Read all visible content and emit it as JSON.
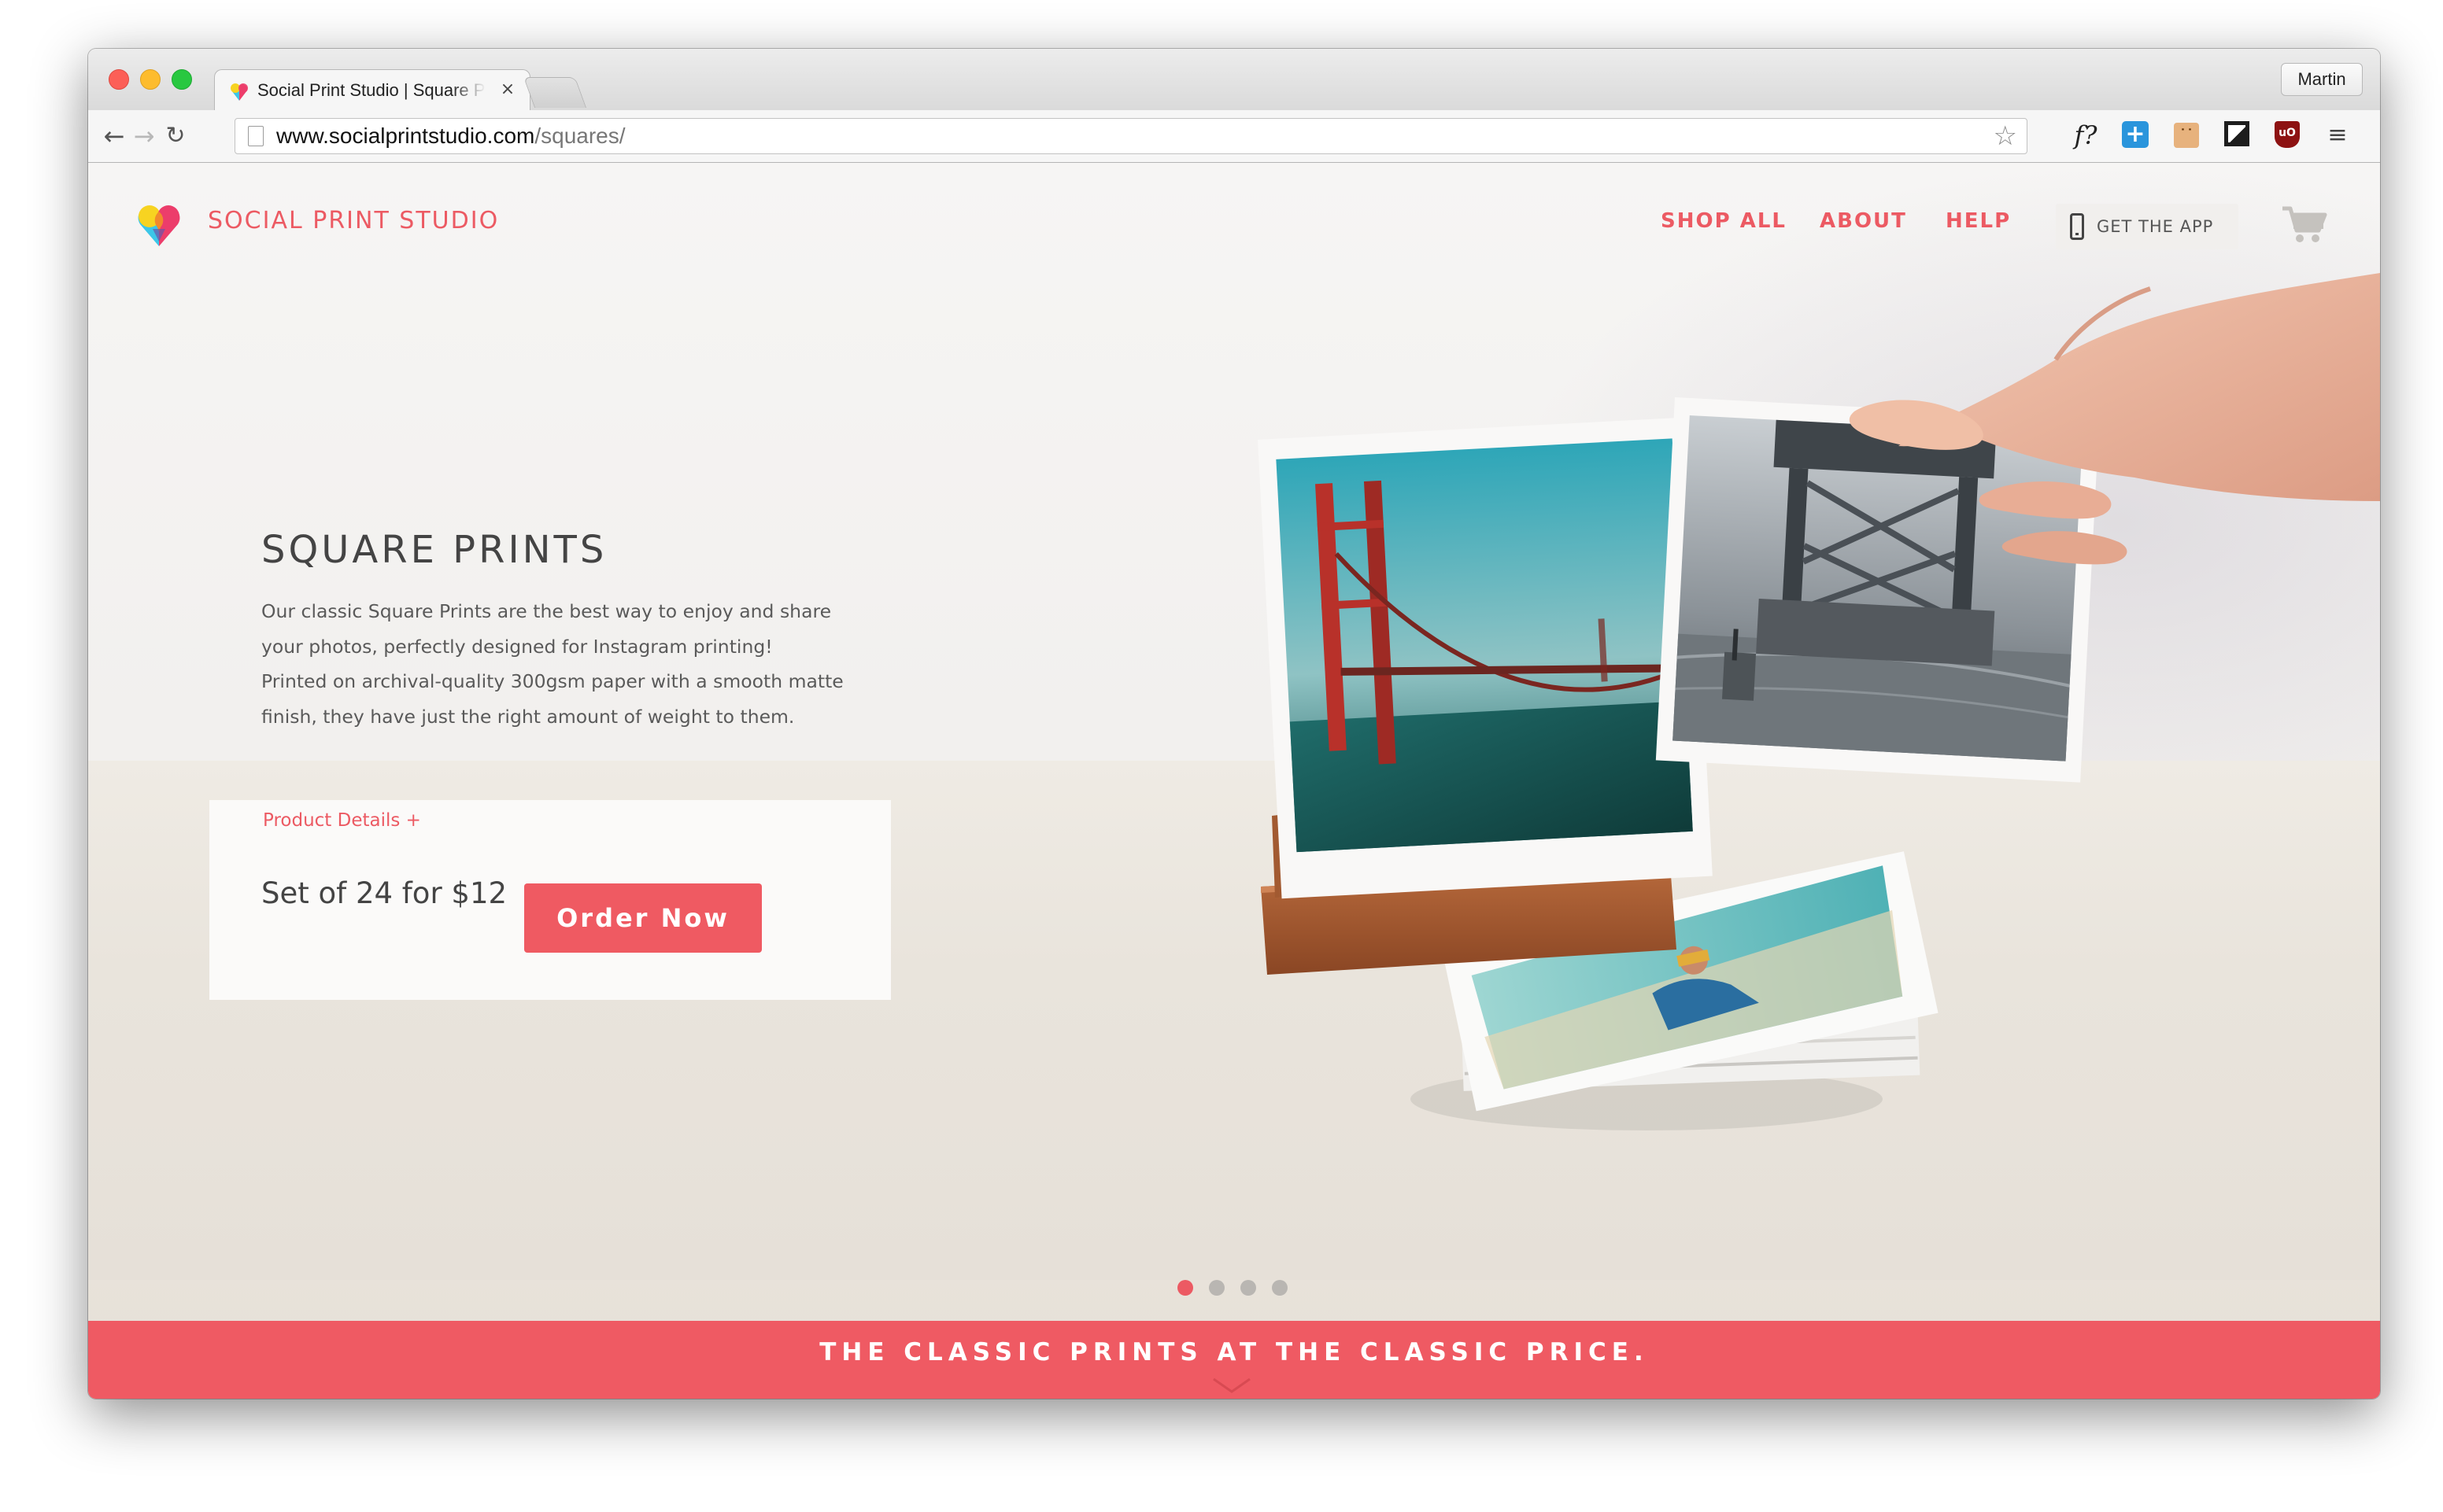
{
  "browser": {
    "tab_title": "Social Print Studio | Square Prints",
    "tab_close": "×",
    "profile_name": "Martin",
    "url_host": "www.socialprintstudio.com",
    "url_path": "/squares/",
    "nav_back": "←",
    "nav_forward": "→",
    "nav_reload": "↻",
    "bookmark_star": "☆",
    "extensions": {
      "fontface": "f?",
      "plus": "+",
      "face": "˙˙",
      "ublock": "uO",
      "menu": "≡"
    }
  },
  "header": {
    "brand": "SOCIAL PRINT STUDIO",
    "nav": {
      "shop_all": "SHOP ALL",
      "about": "ABOUT",
      "help": "HELP"
    },
    "app_button": "GET THE APP"
  },
  "hero": {
    "title": "SQUARE PRINTS",
    "description": "Our classic Square Prints are the best way to enjoy and share your photos, perfectly designed for Instagram printing! Printed on archival-quality 300gsm paper with a smooth matte finish, they have just the right amount of weight to them.",
    "details_link": "Product Details +",
    "price": "Set of 24 for $12",
    "order_button": "Order Now"
  },
  "carousel": {
    "slide_count": 4,
    "active_index": 0
  },
  "banner": {
    "tagline": "THE CLASSIC PRINTS AT THE CLASSIC PRICE."
  },
  "colors": {
    "brand_red": "#ec5a63",
    "banner_red": "#ef5a63",
    "text_dark": "#444444"
  }
}
